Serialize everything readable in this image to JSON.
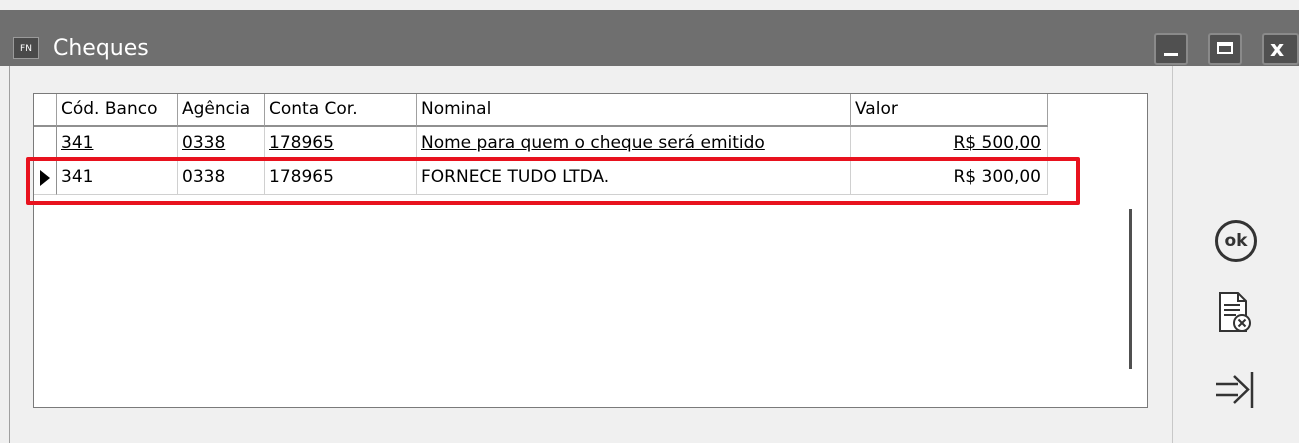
{
  "window": {
    "title": "Cheques",
    "app_icon_text": "FN"
  },
  "grid": {
    "columns": [
      "Cód. Banco",
      "Agência",
      "Conta Cor.",
      "Nominal",
      "Valor"
    ],
    "rows": [
      {
        "banco": "341",
        "agencia": "0338",
        "conta": "178965",
        "nominal": "Nome para quem o cheque será emitido",
        "valor": "R$ 500,00"
      },
      {
        "banco": "341",
        "agencia": "0338",
        "conta": "178965",
        "nominal": "FORNECE TUDO LTDA.",
        "valor": "R$ 300,00"
      }
    ],
    "selected_row": 1
  },
  "sidebar": {
    "ok_label": "ok"
  },
  "colors": {
    "highlight": "#e8121e",
    "titlebar": "#6f6f6f"
  },
  "icons": [
    "minimize-icon",
    "maximize-icon",
    "close-icon",
    "ok-icon",
    "cancel-document-icon",
    "exit-icon",
    "row-indicator-arrow-icon"
  ]
}
